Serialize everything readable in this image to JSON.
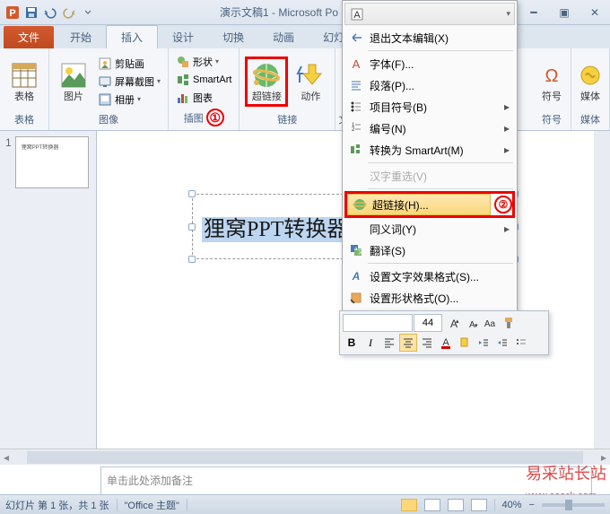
{
  "window": {
    "title": "演示文稿1 - Microsoft Po"
  },
  "tabs": {
    "file": "文件",
    "home": "开始",
    "insert": "插入",
    "design": "设计",
    "trans": "切换",
    "anim": "动画",
    "slideshow": "幻灯片放"
  },
  "ribbon": {
    "table": {
      "label": "表格",
      "group": "表格"
    },
    "image": {
      "label": "图片",
      "clipart": "剪贴画",
      "screenshot": "屏幕截图",
      "album": "相册",
      "group": "图像"
    },
    "illus": {
      "shape": "形状",
      "smartart": "SmartArt",
      "chart": "图表",
      "group": "插图"
    },
    "link": {
      "hyperlink": "超链接",
      "action": "动作",
      "group": "链接"
    },
    "text": {
      "group": "文"
    },
    "symbol": {
      "label": "符号",
      "group": "符号"
    },
    "media": {
      "label": "媒体",
      "group": "媒体"
    }
  },
  "callouts": {
    "one": "①",
    "two": "②"
  },
  "context": {
    "exit_text_edit": "退出文本编辑(X)",
    "font": "字体(F)...",
    "paragraph": "段落(P)...",
    "bullets": "项目符号(B)",
    "numbering": "编号(N)",
    "convert_smartart": "转换为 SmartArt(M)",
    "hanzi": "汉字重选(V)",
    "hyperlink": "超链接(H)...",
    "synonym": "同义词(Y)",
    "translate": "翻译(S)",
    "text_effects": "设置文字效果格式(S)...",
    "shape_format": "设置形状格式(O)..."
  },
  "mini": {
    "font_size": "44",
    "bold": "B",
    "italic": "I"
  },
  "slide": {
    "num": "1",
    "thumb_text": "狸窝PPT转换器",
    "selected_text": "狸窝PPT转换器"
  },
  "notes": {
    "placeholder": "单击此处添加备注"
  },
  "status": {
    "slide": "幻灯片 第 1 张，共 1 张",
    "theme": "\"Office 主题\"",
    "zoom": "40%"
  },
  "watermark": "易采站长站",
  "site": "www.easck.com"
}
